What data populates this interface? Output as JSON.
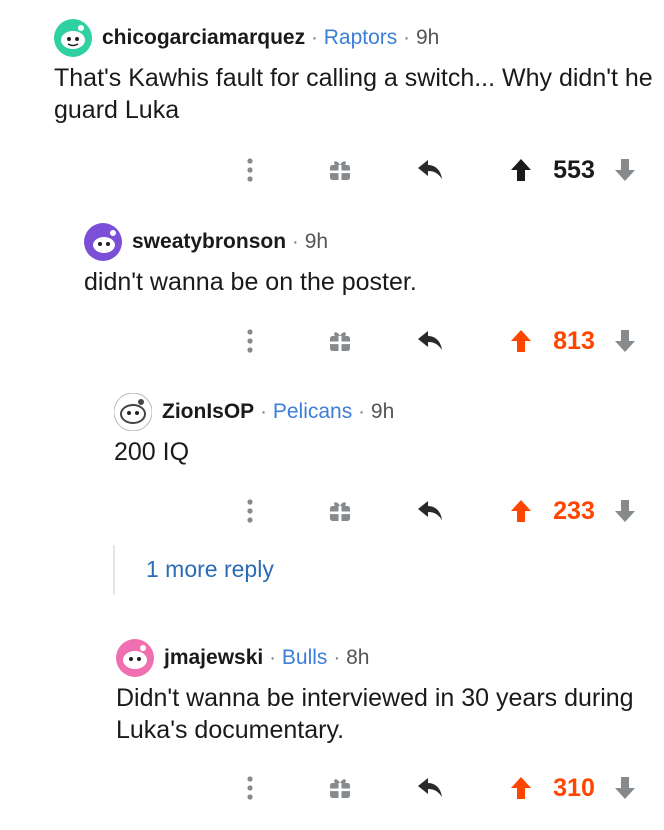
{
  "comments": [
    {
      "username": "chicogarciamarquez",
      "flair": "Raptors",
      "time": "9h",
      "body": "That's Kawhis fault for calling a switch... Why didn't he guard Luka",
      "score": "553",
      "upvoted": false,
      "avatar_color": "#2fd1a0"
    },
    {
      "username": "sweatybronson",
      "flair": "",
      "time": "9h",
      "body": "didn't wanna be on the poster.",
      "score": "813",
      "upvoted": true,
      "avatar_color": "#7b4fd6"
    },
    {
      "username": "ZionIsOP",
      "flair": "Pelicans",
      "time": "9h",
      "body": "200 IQ",
      "score": "233",
      "upvoted": true,
      "avatar_color": "#9aa0a6"
    },
    {
      "username": "jmajewski",
      "flair": "Bulls",
      "time": "8h",
      "body": "Didn't wanna be interviewed in 30 years during Luka's documentary.",
      "score": "310",
      "upvoted": true,
      "avatar_color": "#f06fb0"
    }
  ],
  "more_replies": "1 more reply",
  "colors": {
    "upvote_active": "#ff4500",
    "icon_gray": "#878a8c",
    "flair_blue": "#3b7fd6",
    "thread_line": "#e4e4e4"
  },
  "icons": [
    "more-icon",
    "award-icon",
    "reply-icon",
    "upvote-icon",
    "downvote-icon"
  ]
}
